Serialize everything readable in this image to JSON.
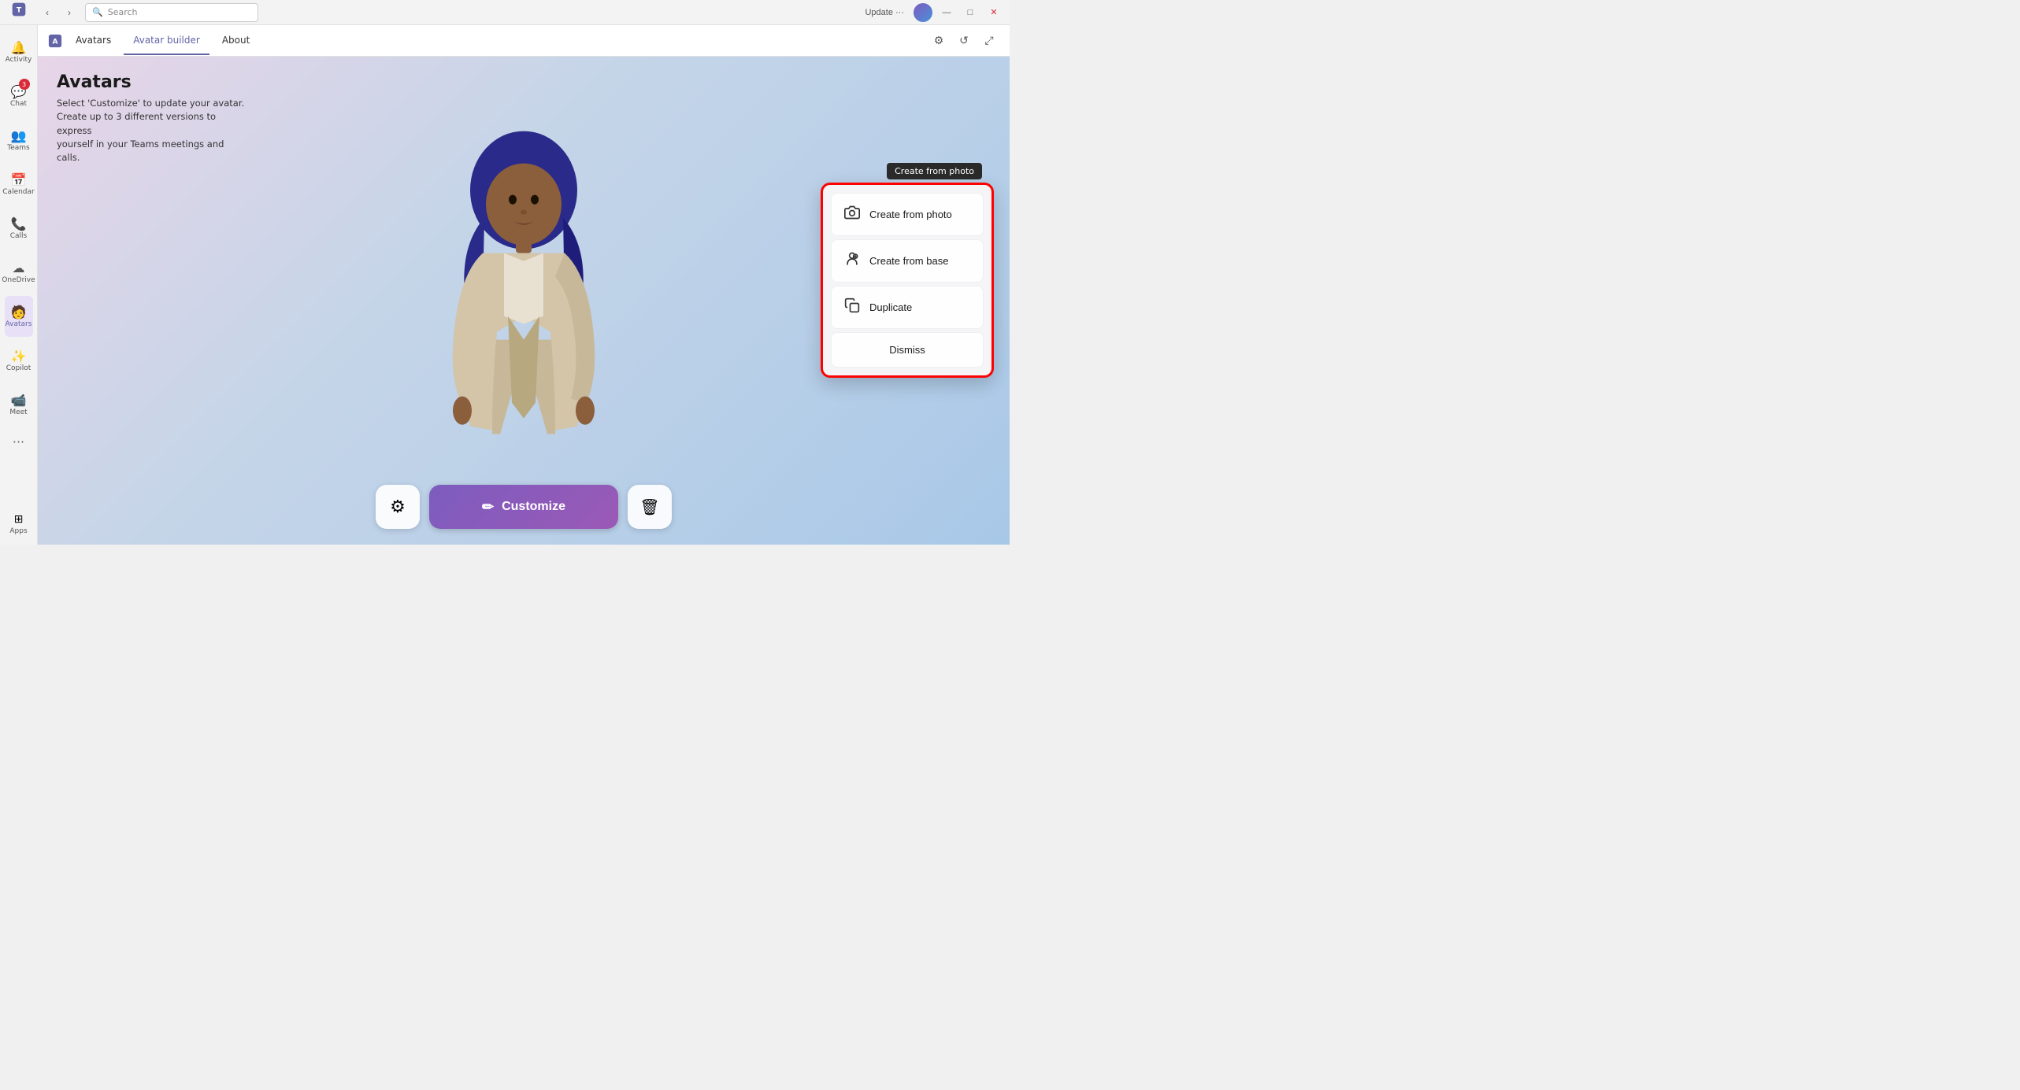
{
  "titlebar": {
    "update_label": "Update ···",
    "search_placeholder": "Search"
  },
  "tabs": {
    "app_name": "Avatars",
    "items": [
      {
        "id": "avatars",
        "label": "Avatars",
        "active": true
      },
      {
        "id": "avatar-builder",
        "label": "Avatar builder",
        "active": false
      },
      {
        "id": "about",
        "label": "About",
        "active": false
      }
    ]
  },
  "sidebar": {
    "items": [
      {
        "id": "activity",
        "label": "Activity",
        "icon": "🔔",
        "badge": null
      },
      {
        "id": "chat",
        "label": "Chat",
        "icon": "💬",
        "badge": "3"
      },
      {
        "id": "teams",
        "label": "Teams",
        "icon": "👥",
        "badge": null
      },
      {
        "id": "calendar",
        "label": "Calendar",
        "icon": "📅",
        "badge": null
      },
      {
        "id": "calls",
        "label": "Calls",
        "icon": "📞",
        "badge": null
      },
      {
        "id": "onedrive",
        "label": "OneDrive",
        "icon": "☁",
        "badge": null
      },
      {
        "id": "avatars",
        "label": "Avatars",
        "icon": "🧑",
        "badge": null,
        "active": true
      },
      {
        "id": "copilot",
        "label": "Copilot",
        "icon": "✨",
        "badge": null
      },
      {
        "id": "meet",
        "label": "Meet",
        "icon": "📹",
        "badge": null
      }
    ]
  },
  "page": {
    "title": "Avatars",
    "description": "Select 'Customize' to update your avatar.\nCreate up to 3 different versions to express\nyourself in your Teams meetings and calls."
  },
  "toolbar": {
    "settings_icon": "⚙",
    "customize_icon": "✏",
    "customize_label": "Customize",
    "delete_icon": "🗑"
  },
  "dropdown": {
    "tooltip": "Create from photo",
    "items": [
      {
        "id": "create-from-photo",
        "label": "Create from photo",
        "icon": "📷"
      },
      {
        "id": "create-from-base",
        "label": "Create from base",
        "icon": "👤"
      },
      {
        "id": "duplicate",
        "label": "Duplicate",
        "icon": "📋"
      },
      {
        "id": "dismiss",
        "label": "Dismiss",
        "icon": null
      }
    ]
  }
}
